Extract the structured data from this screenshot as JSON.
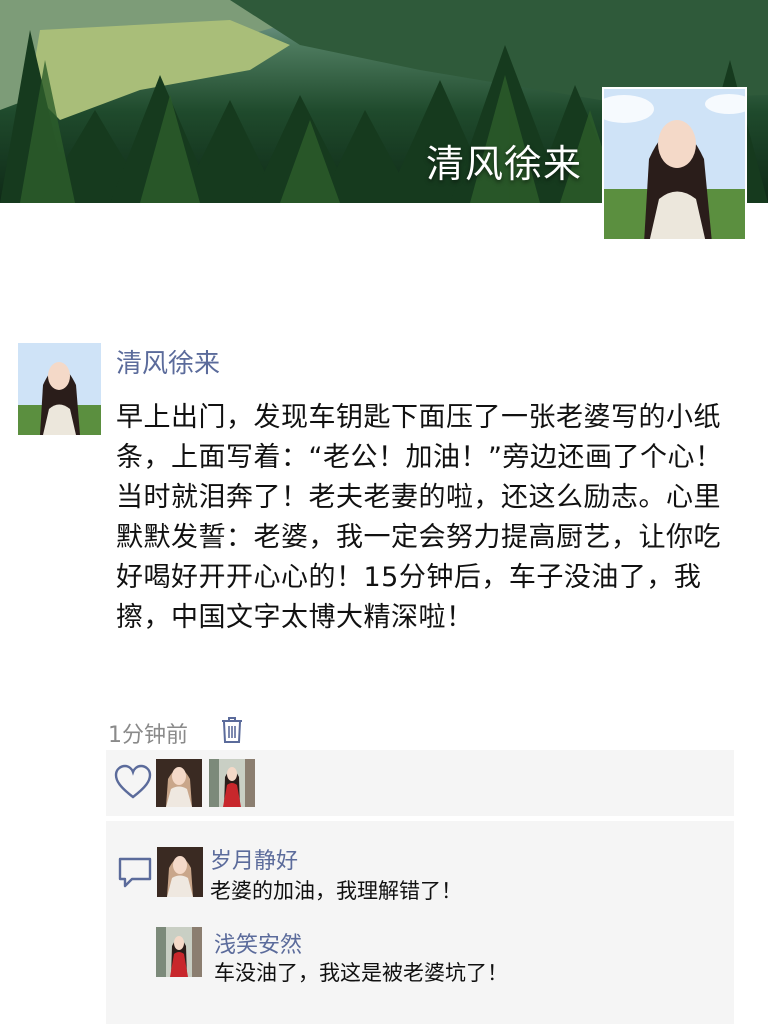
{
  "cover": {
    "name": "清风徐来"
  },
  "post": {
    "author": "清风徐来",
    "text": "早上出门，发现车钥匙下面压了一张老婆写的小纸条，上面写着：“老公！加油！”旁边还画了个心！当时就泪奔了！老夫老妻的啦，还这么励志。心里默默发誓：老婆，我一定会努力提高厨艺，让你吃好喝好开开心心的！15分钟后，车子没油了，我擦，中国文字太博大精深啦！",
    "time": "1分钟前"
  },
  "likes": {
    "icon": "heart-icon",
    "avatars": [
      "avatar-girl-white-dress",
      "avatar-girl-red-dress"
    ]
  },
  "comments": [
    {
      "name": "岁月静好",
      "text": "老婆的加油，我理解错了！",
      "avatar": "avatar-girl-white-dress"
    },
    {
      "name": "浅笑安然",
      "text": "车没油了，我这是被老婆坑了！",
      "avatar": "avatar-girl-red-dress"
    }
  ],
  "colors": {
    "name_link": "#5b6b9b",
    "panel_bg": "#f5f5f5",
    "text": "#111111",
    "time": "#8a8a8a"
  }
}
